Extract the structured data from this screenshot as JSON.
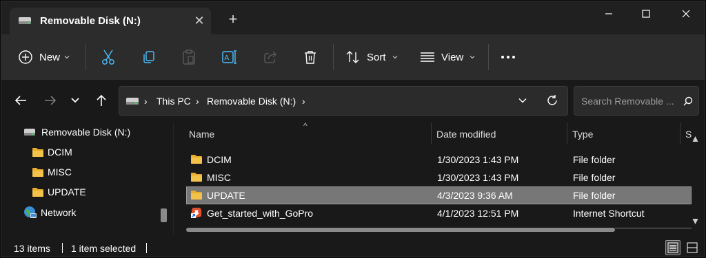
{
  "window": {
    "tab_title": "Removable Disk (N:)",
    "tab_close": "✕",
    "new_tab": "+"
  },
  "toolbar": {
    "new_label": "New",
    "sort_label": "Sort",
    "view_label": "View"
  },
  "address": {
    "crumbs": [
      "This PC",
      "Removable Disk (N:)"
    ],
    "separator": "›",
    "search_placeholder": "Search Removable ..."
  },
  "nav": {
    "items": [
      {
        "label": "Removable Disk (N:)",
        "icon": "drive-icon"
      },
      {
        "label": "DCIM",
        "icon": "folder-icon"
      },
      {
        "label": "MISC",
        "icon": "folder-icon"
      },
      {
        "label": "UPDATE",
        "icon": "folder-icon"
      },
      {
        "label": "Network",
        "icon": "network-icon"
      }
    ]
  },
  "filelist": {
    "sort_indicator": "^",
    "columns": [
      "Name",
      "Date modified",
      "Type",
      "S"
    ],
    "rows": [
      {
        "name": "DCIM",
        "date": "1/30/2023 1:43 PM",
        "type": "File folder",
        "icon": "folder-icon",
        "selected": false
      },
      {
        "name": "MISC",
        "date": "1/30/2023 1:43 PM",
        "type": "File folder",
        "icon": "folder-icon",
        "selected": false
      },
      {
        "name": "UPDATE",
        "date": "4/3/2023 9:36 AM",
        "type": "File folder",
        "icon": "folder-icon",
        "selected": true
      },
      {
        "name": "Get_started_with_GoPro",
        "date": "4/1/2023 12:51 PM",
        "type": "Internet Shortcut",
        "icon": "internet-shortcut-icon",
        "selected": false
      }
    ]
  },
  "status": {
    "item_count": "13 items",
    "selection": "1 item selected"
  },
  "colors": {
    "accent_folder": "#f3c24a",
    "selection": "#777777",
    "background": "#191919",
    "toolbar": "#2c2c2c"
  }
}
